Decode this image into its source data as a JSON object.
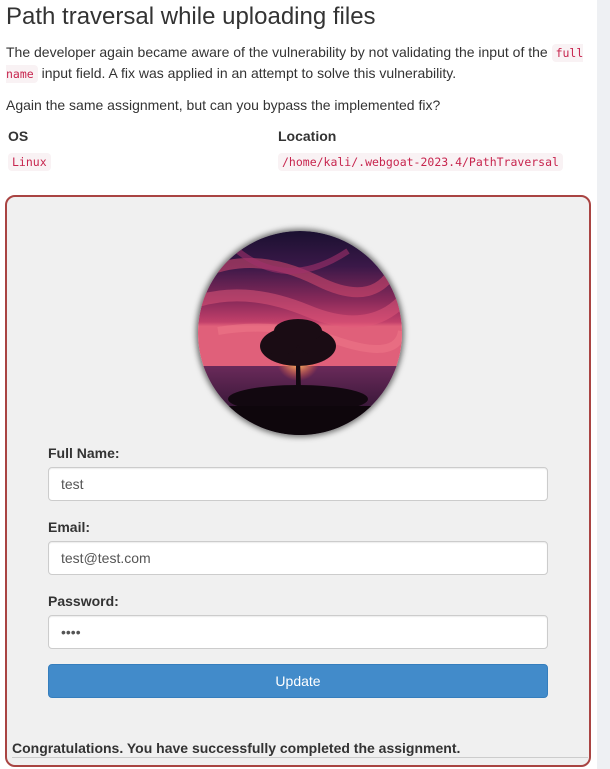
{
  "lesson": {
    "title": "Path traversal while uploading files",
    "intro_before": "The developer again became aware of the vulnerability by not validating the input of the ",
    "intro_code": "full name",
    "intro_after": " input field. A fix was applied in an attempt to solve this vulnerability.",
    "assignment_text": "Again the same assignment, but can you bypass the implemented fix?"
  },
  "info_table": {
    "headers": [
      "OS",
      "Location"
    ],
    "os_value": "Linux",
    "location_value": "/home/kali/.webgoat-2023.4/PathTraversal"
  },
  "form": {
    "full_name_label": "Full Name:",
    "full_name_value": "test",
    "email_label": "Email:",
    "email_value": "test@test.com",
    "password_label": "Password:",
    "password_value": "test",
    "update_label": "Update",
    "profile_image": "sunset-tree-photo",
    "border_color": "#a94442",
    "button_color": "#428bca"
  },
  "feedback": {
    "message": "Congratulations. You have successfully completed the assignment."
  },
  "colors": {
    "code_text": "#c7254e",
    "code_bg": "#f9f2f4",
    "form_bg": "#f0f0f0"
  }
}
